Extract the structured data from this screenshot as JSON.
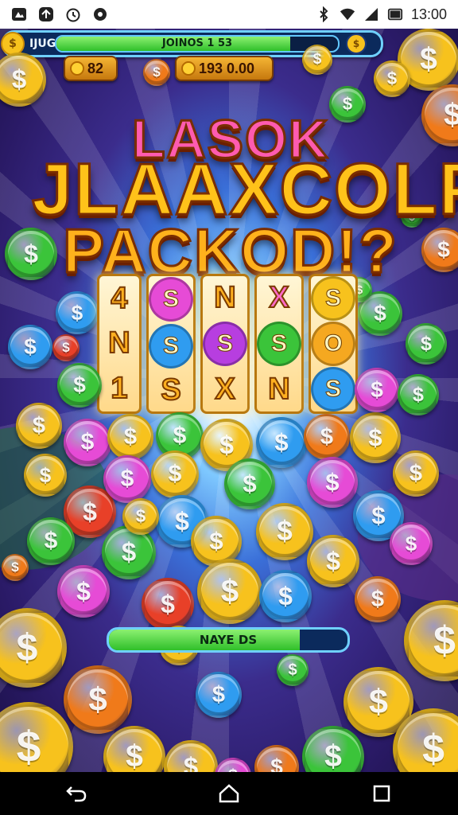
{
  "status_bar": {
    "time": "13:00",
    "left_icons": [
      "app-icon",
      "flip-icon",
      "clock-icon",
      "settings-icon"
    ],
    "right_icons": [
      "bluetooth-icon",
      "wifi-icon",
      "signal-icon",
      "battery-icon"
    ]
  },
  "top_bar": {
    "label": "IJUG",
    "progress_text": "JOINOS 1 53",
    "progress_fraction": 0.83,
    "left_coin_glyph": "$",
    "right_coin_glyph": "$"
  },
  "counters": {
    "coins_value": "82",
    "balance_value": "193 0.00"
  },
  "title": {
    "line1": "LASOK",
    "line2": "JLAAXCOLP",
    "line3": "PACKOD!?"
  },
  "reels": [
    [
      "4",
      "N",
      "1"
    ],
    [
      "S",
      "S",
      "S"
    ],
    [
      "N",
      "S",
      "X"
    ],
    [
      "X",
      "S",
      "N"
    ],
    [
      "S",
      "O",
      "S"
    ]
  ],
  "bottom_bar": {
    "progress_text": "NAYE DS",
    "progress_fraction": 0.8
  },
  "colors": {
    "gold": "#f7c21d",
    "green": "#3bc43a",
    "blue": "#2f9cf0",
    "pink": "#e64bd6",
    "orange": "#f07a1a",
    "red": "#e84028"
  },
  "nav_bar": {
    "icons": [
      "back-icon",
      "home-icon",
      "recents-icon"
    ]
  }
}
